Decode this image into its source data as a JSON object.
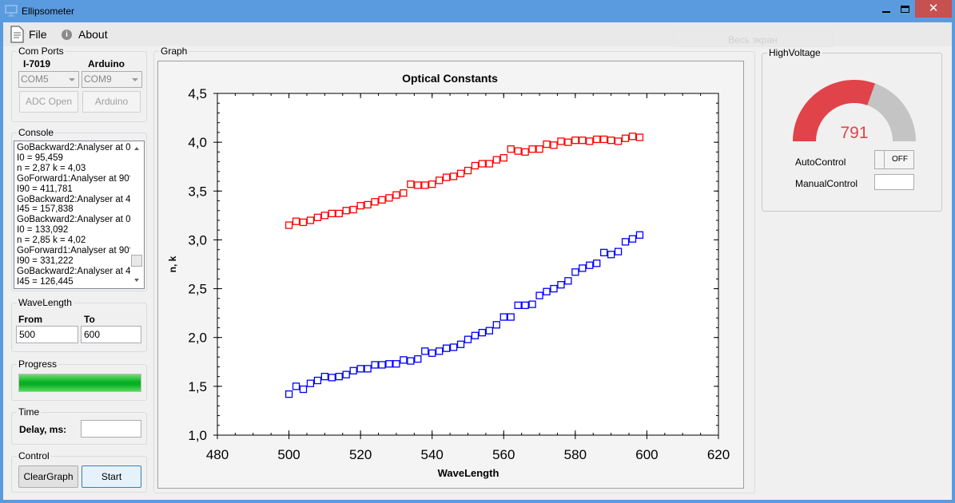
{
  "window": {
    "title": "Ellipsometer",
    "overlay_label": "Весь экран"
  },
  "menu": {
    "file": "File",
    "about": "About"
  },
  "com_ports": {
    "title": "Com Ports",
    "i7019_label": "I-7019",
    "arduino_label": "Arduino",
    "i7019_port": "COM5",
    "arduino_port": "COM9",
    "adc_open": "ADC Open",
    "arduino_button": "Arduino"
  },
  "console": {
    "title": "Console",
    "lines": [
      "GoBackward2:Analyser at 0°",
      "I0 = 95,459",
      "n = 2,87 k = 4,03",
      "GoForward1:Analyser at 90°",
      "I90 = 411,781",
      "GoBackward2:Analyser at 45°",
      "I45 = 157,838",
      "GoBackward2:Analyser at 0°",
      "I0 = 133,092",
      "n = 2,85 k = 4,02",
      "GoForward1:Analyser at 90°",
      "I90 = 331,222",
      "GoBackward2:Analyser at 45°",
      "I45 = 126,445"
    ]
  },
  "wavelength": {
    "title": "WaveLength",
    "from_label": "From",
    "to_label": "To",
    "from_value": "500",
    "to_value": "600"
  },
  "progress": {
    "title": "Progress",
    "value": 1.0
  },
  "time": {
    "title": "Time",
    "delay_label": "Delay, ms:",
    "delay_value": ""
  },
  "control": {
    "title": "Control",
    "clear": "ClearGraph",
    "start": "Start"
  },
  "graph": {
    "title": "Graph"
  },
  "high_voltage": {
    "title": "HighVoltage",
    "value": "791",
    "gauge_fraction": 0.61,
    "gauge_color": "#e0434a",
    "gauge_bg": "#c4c4c4",
    "auto_label": "AutoControl",
    "toggle": "OFF",
    "manual_label": "ManualControl",
    "manual_value": ""
  },
  "chart_data": {
    "type": "scatter",
    "title": "Optical Constants",
    "xlabel": "WaveLength",
    "ylabel": "n, k",
    "xlim": [
      480,
      620
    ],
    "ylim": [
      1.0,
      4.5
    ],
    "xticks": [
      "480",
      "500",
      "520",
      "540",
      "560",
      "580",
      "600",
      "620"
    ],
    "yticks": [
      "1,0",
      "1,5",
      "2,0",
      "2,5",
      "3,0",
      "3,5",
      "4,0",
      "4,5"
    ],
    "x": [
      500,
      502,
      504,
      506,
      508,
      510,
      512,
      514,
      516,
      518,
      520,
      522,
      524,
      526,
      528,
      530,
      532,
      534,
      536,
      538,
      540,
      542,
      544,
      546,
      548,
      550,
      552,
      554,
      556,
      558,
      560,
      562,
      564,
      566,
      568,
      570,
      572,
      574,
      576,
      578,
      580,
      582,
      584,
      586,
      588,
      590,
      592,
      594,
      596,
      598
    ],
    "series": [
      {
        "color": "#ff0000",
        "marker": "square",
        "values": [
          3.15,
          3.19,
          3.18,
          3.2,
          3.23,
          3.25,
          3.27,
          3.27,
          3.3,
          3.31,
          3.35,
          3.36,
          3.39,
          3.41,
          3.43,
          3.46,
          3.48,
          3.57,
          3.56,
          3.56,
          3.57,
          3.61,
          3.64,
          3.65,
          3.68,
          3.71,
          3.76,
          3.78,
          3.78,
          3.82,
          3.84,
          3.93,
          3.91,
          3.9,
          3.93,
          3.93,
          3.98,
          3.97,
          4.01,
          4.0,
          4.02,
          4.02,
          4.01,
          4.03,
          4.03,
          4.02,
          4.01,
          4.04,
          4.06,
          4.05
        ]
      },
      {
        "color": "#0000ff",
        "marker": "square",
        "values": [
          1.42,
          1.5,
          1.47,
          1.53,
          1.56,
          1.6,
          1.59,
          1.6,
          1.62,
          1.66,
          1.68,
          1.68,
          1.72,
          1.72,
          1.73,
          1.73,
          1.77,
          1.76,
          1.78,
          1.86,
          1.84,
          1.86,
          1.89,
          1.9,
          1.93,
          1.98,
          2.02,
          2.05,
          2.07,
          2.13,
          2.21,
          2.21,
          2.33,
          2.33,
          2.34,
          2.43,
          2.47,
          2.5,
          2.54,
          2.58,
          2.67,
          2.71,
          2.74,
          2.76,
          2.87,
          2.85,
          2.88,
          2.98,
          3.01,
          3.05
        ]
      }
    ],
    "grid": false,
    "legend": "none"
  }
}
